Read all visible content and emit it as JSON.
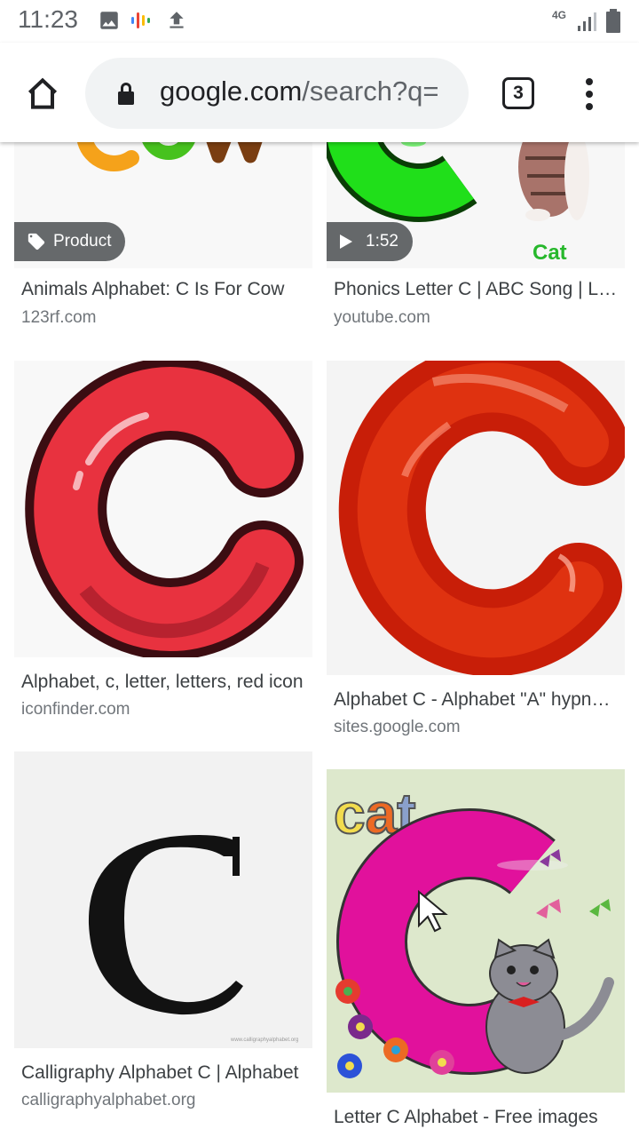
{
  "status_bar": {
    "time": "11:23",
    "network": "4G"
  },
  "browser": {
    "url_domain": "google.com",
    "url_rest": "/search?q=",
    "tab_count": "3"
  },
  "results": [
    {
      "title": "Animals Alphabet: C Is For Cow",
      "domain": "123rf.com",
      "badge": "Product",
      "image_text": "Cow"
    },
    {
      "title": "Phonics Letter C | ABC Song | Learn Phonics",
      "domain": "youtube.com",
      "badge": "1:52",
      "image_text": "Cat"
    },
    {
      "title": "Alphabet, c, letter, letters, red icon",
      "domain": "iconfinder.com"
    },
    {
      "title": "Alphabet C - Alphabet \"A\" hypnotic",
      "domain": "sites.google.com"
    },
    {
      "title": "Calligraphy Alphabet C | Alphabet",
      "domain": "calligraphyalphabet.org",
      "image_text": "www.calligraphyalphabet.org"
    },
    {
      "title": "Letter C Alphabet - Free images",
      "domain": "",
      "image_text": "cat"
    }
  ],
  "colors": {
    "accent": "#ea4335",
    "url_bar": "#f1f3f4",
    "badge_bg": "#3c4043"
  },
  "icons": [
    "image-icon",
    "google-assistant-icon",
    "upload-icon",
    "signal-icon",
    "battery-icon",
    "home-icon",
    "lock-icon",
    "tabs-icon",
    "more-vert-icon",
    "tag-icon",
    "play-icon"
  ]
}
